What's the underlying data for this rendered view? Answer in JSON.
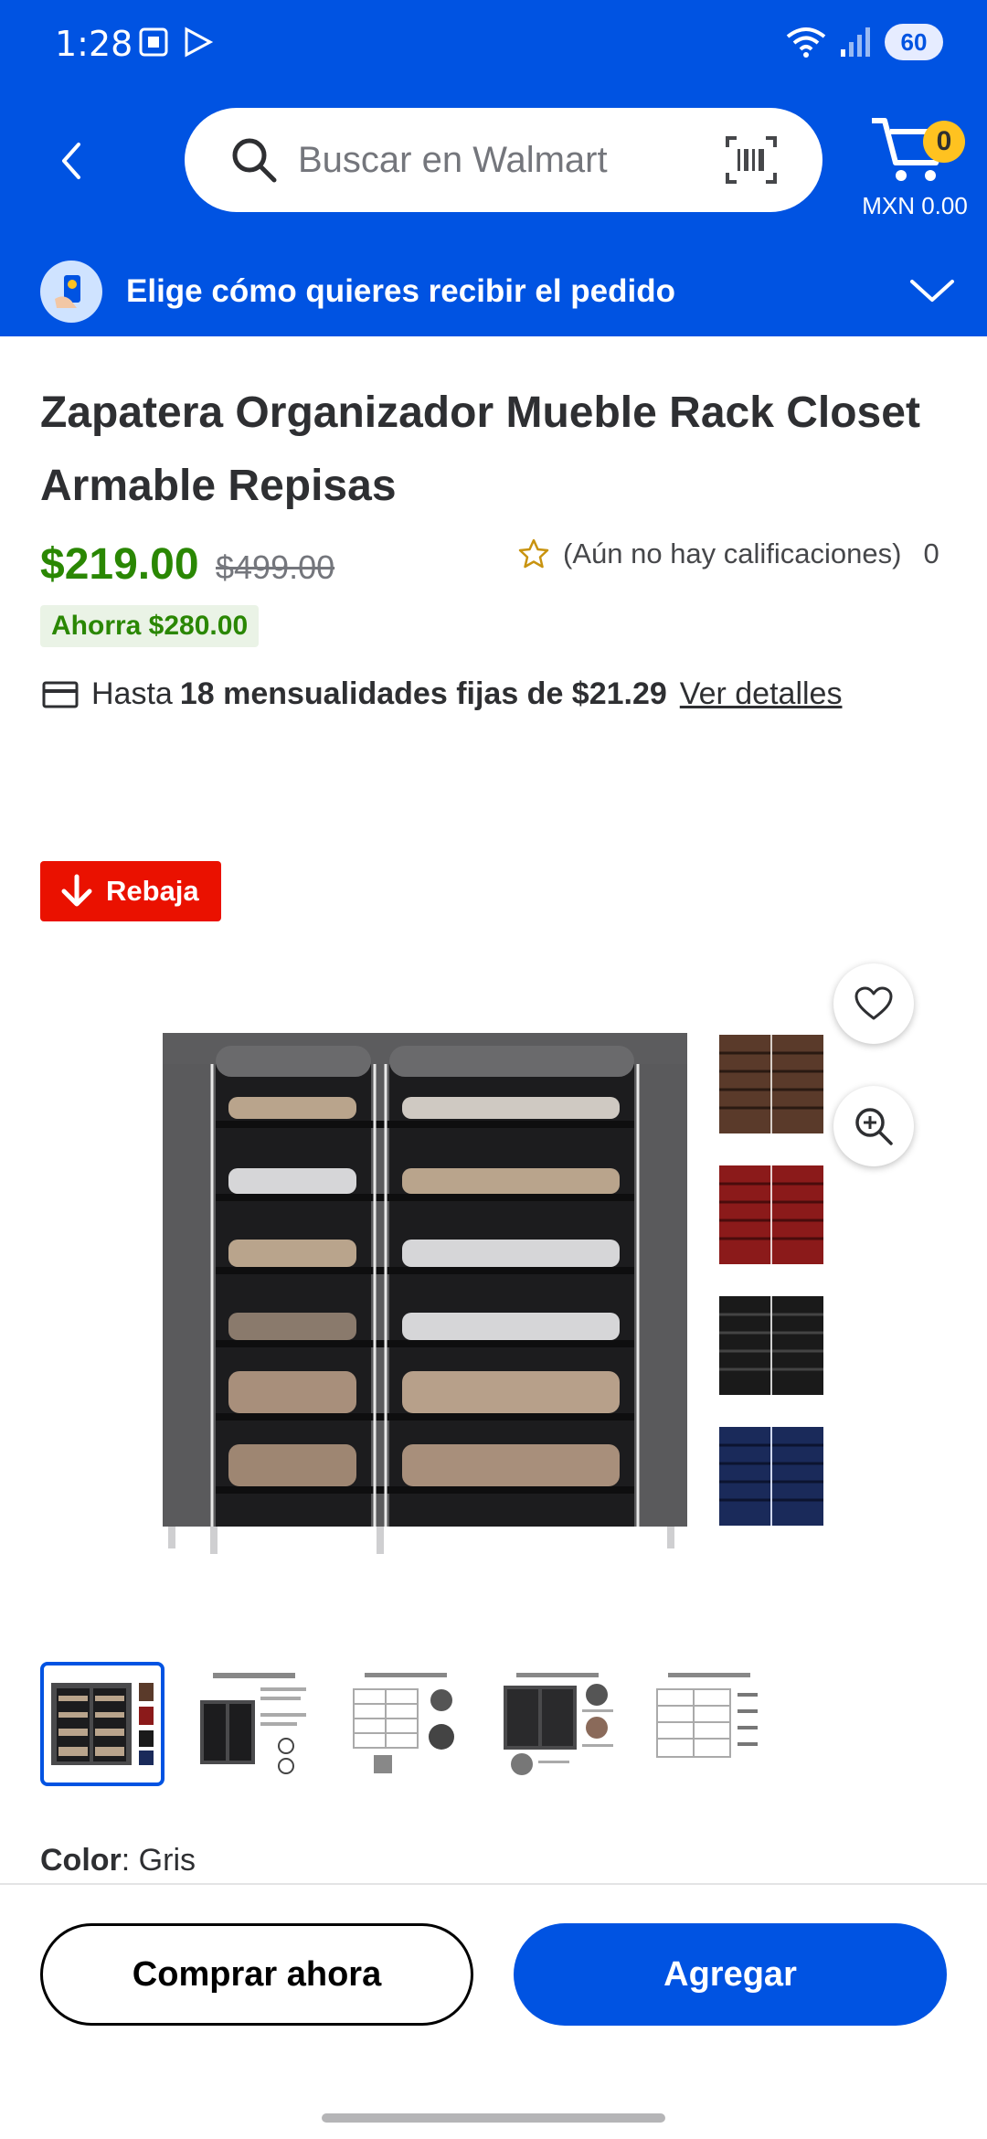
{
  "status_bar": {
    "time": "1:28",
    "battery": "60"
  },
  "search": {
    "placeholder": "Buscar en Walmart"
  },
  "cart": {
    "count": "0",
    "total": "MXN 0.00"
  },
  "delivery": {
    "label": "Elige cómo quieres recibir el pedido"
  },
  "product": {
    "title": "Zapatera Organizador Mueble Rack Closet Armable Repisas",
    "price": "$219.00",
    "was_price": "$499.00",
    "rating_text": "(Aún no hay calificaciones)",
    "rating_count": "0",
    "savings": "Ahorra $280.00",
    "installments_prefix": "Hasta",
    "installments_strong": "18 mensualidades fijas de $21.29",
    "installments_link": "Ver detalles",
    "badge": "Rebaja",
    "color_label": "Color",
    "color_value": ": Gris",
    "swatch_colors": [
      "#5a3a2a",
      "#8b1a1a",
      "#1a1a1a",
      "#1a2a5a"
    ],
    "main_color": "#4a4a4c"
  },
  "actions": {
    "buy_now": "Comprar ahora",
    "add": "Agregar"
  },
  "colors": {
    "brand_blue": "#0053e2",
    "price_green": "#2a8703",
    "sale_red": "#ea1100",
    "cart_badge": "#ffc220"
  }
}
